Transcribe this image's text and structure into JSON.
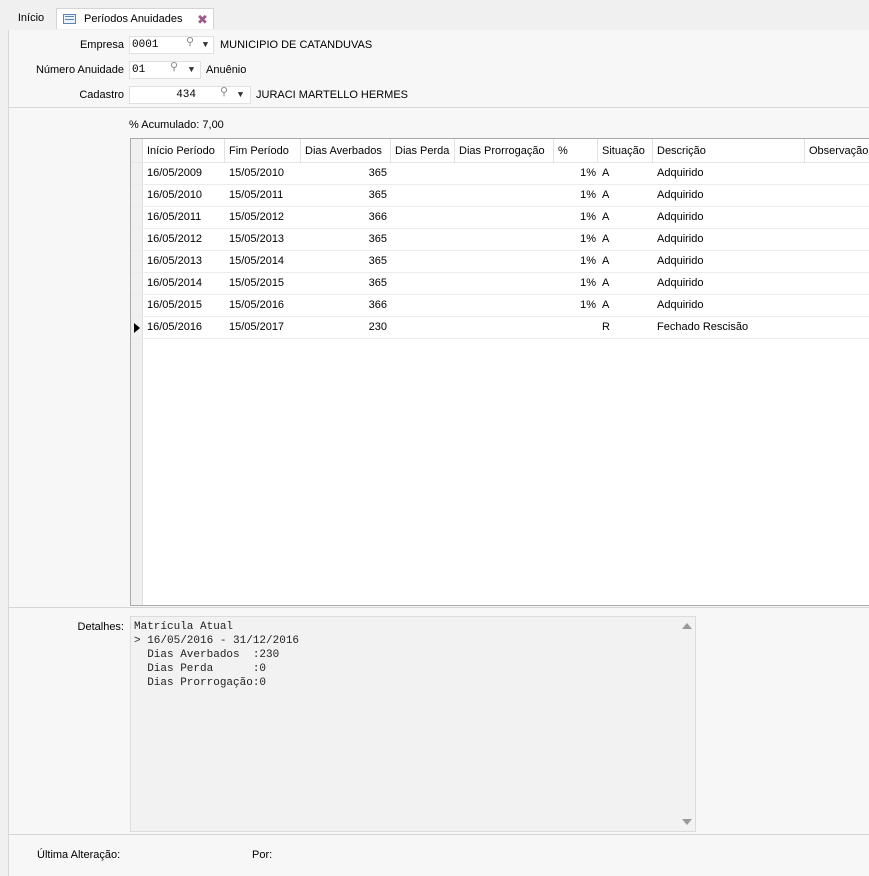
{
  "tabs": {
    "home": "Início",
    "active": "Períodos Anuidades",
    "close_glyph": "✖"
  },
  "form": {
    "empresa": {
      "label": "Empresa",
      "value": "0001",
      "description": "MUNICIPIO DE CATANDUVAS"
    },
    "numero_anuidade": {
      "label": "Número Anuidade",
      "value": "01",
      "description": "Anuênio"
    },
    "cadastro": {
      "label": "Cadastro",
      "value": "434",
      "description": "JURACI MARTELLO HERMES"
    }
  },
  "accumulated": {
    "label": "% Acumulado:",
    "value": "7,00"
  },
  "grid": {
    "columns": [
      "Início Período",
      "Fim Período",
      "Dias Averbados",
      "Dias Perda",
      "Dias Prorrogação",
      "%",
      "Situação",
      "Descrição",
      "Observação"
    ],
    "rows": [
      {
        "inicio": "16/05/2009",
        "fim": "15/05/2010",
        "averbados": "365",
        "perda": "",
        "prorrogacao": "",
        "pct": "1%",
        "situacao": "A",
        "descricao": "Adquirido",
        "observacao": ""
      },
      {
        "inicio": "16/05/2010",
        "fim": "15/05/2011",
        "averbados": "365",
        "perda": "",
        "prorrogacao": "",
        "pct": "1%",
        "situacao": "A",
        "descricao": "Adquirido",
        "observacao": ""
      },
      {
        "inicio": "16/05/2011",
        "fim": "15/05/2012",
        "averbados": "366",
        "perda": "",
        "prorrogacao": "",
        "pct": "1%",
        "situacao": "A",
        "descricao": "Adquirido",
        "observacao": ""
      },
      {
        "inicio": "16/05/2012",
        "fim": "15/05/2013",
        "averbados": "365",
        "perda": "",
        "prorrogacao": "",
        "pct": "1%",
        "situacao": "A",
        "descricao": "Adquirido",
        "observacao": ""
      },
      {
        "inicio": "16/05/2013",
        "fim": "15/05/2014",
        "averbados": "365",
        "perda": "",
        "prorrogacao": "",
        "pct": "1%",
        "situacao": "A",
        "descricao": "Adquirido",
        "observacao": ""
      },
      {
        "inicio": "16/05/2014",
        "fim": "15/05/2015",
        "averbados": "365",
        "perda": "",
        "prorrogacao": "",
        "pct": "1%",
        "situacao": "A",
        "descricao": "Adquirido",
        "observacao": ""
      },
      {
        "inicio": "16/05/2015",
        "fim": "15/05/2016",
        "averbados": "366",
        "perda": "",
        "prorrogacao": "",
        "pct": "1%",
        "situacao": "A",
        "descricao": "Adquirido",
        "observacao": ""
      },
      {
        "inicio": "16/05/2016",
        "fim": "15/05/2017",
        "averbados": "230",
        "perda": "",
        "prorrogacao": "",
        "pct": "",
        "situacao": "R",
        "descricao": "Fechado Rescisão",
        "observacao": ""
      }
    ],
    "current_row": 7
  },
  "details": {
    "label": "Detalhes:",
    "text": "Matrícula Atual\n> 16/05/2016 - 31/12/2016\n  Dias Averbados  :230\n  Dias Perda      :0\n  Dias Prorrogação:0"
  },
  "footer": {
    "ultima_alteracao_label": "Última Alteração:",
    "por_label": "Por:"
  }
}
